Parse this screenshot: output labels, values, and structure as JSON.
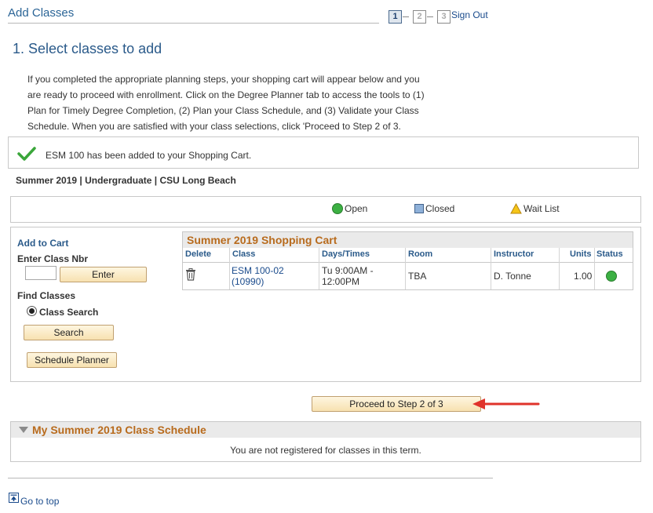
{
  "header": {
    "title": "Add Classes",
    "steps": [
      "1",
      "2",
      "3"
    ],
    "sign_out": "Sign Out"
  },
  "section": {
    "heading": "1.  Select classes to add",
    "intro": "If you completed the appropriate planning steps, your shopping cart will appear below and you are ready to proceed with enrollment. Click on the Degree Planner tab to access the tools to (1) Plan for Timely Degree Completion, (2) Plan your Class Schedule, and (3) Validate your Class Schedule. When you are satisfied with your class selections, click 'Proceed to Step 2 of 3."
  },
  "message": {
    "text": "ESM  100 has been added to your Shopping Cart.",
    "icon": "checkmark-icon",
    "color": "#3aa63a"
  },
  "term": {
    "label": "Summer 2019 | Undergraduate | CSU Long Beach"
  },
  "legend": {
    "open": "Open",
    "closed": "Closed",
    "wait_list": "Wait List"
  },
  "add_to_cart": {
    "title": "Add to Cart",
    "enter_class_nbr": "Enter Class Nbr",
    "class_nbr_value": "",
    "enter_button": "Enter",
    "find_classes": "Find Classes",
    "class_search_option": "Class Search",
    "search_button": "Search",
    "schedule_planner_button": "Schedule Planner"
  },
  "cart": {
    "title": "Summer 2019 Shopping Cart",
    "columns": [
      "Delete",
      "Class",
      "Days/Times",
      "Room",
      "Instructor",
      "Units",
      "Status"
    ],
    "rows": [
      {
        "class_line1": "ESM 100-02",
        "class_line2": "(10990)",
        "days_line1": "Tu 9:00AM -",
        "days_line2": "12:00PM",
        "room": "TBA",
        "instructor": "D. Tonne",
        "units": "1.00",
        "status": "Open"
      }
    ]
  },
  "proceed_button": "Proceed to Step 2 of 3",
  "schedule": {
    "title": "My Summer 2019 Class Schedule",
    "empty_message": "You are not registered for classes in this term."
  },
  "footer": {
    "go_to_top": "Go to top"
  },
  "colors": {
    "link": "#1a4b8c",
    "heading": "#2a5a8a",
    "grid_title": "#b86b1d",
    "open_green": "#3cb043",
    "arrow_red": "#e0332b"
  }
}
